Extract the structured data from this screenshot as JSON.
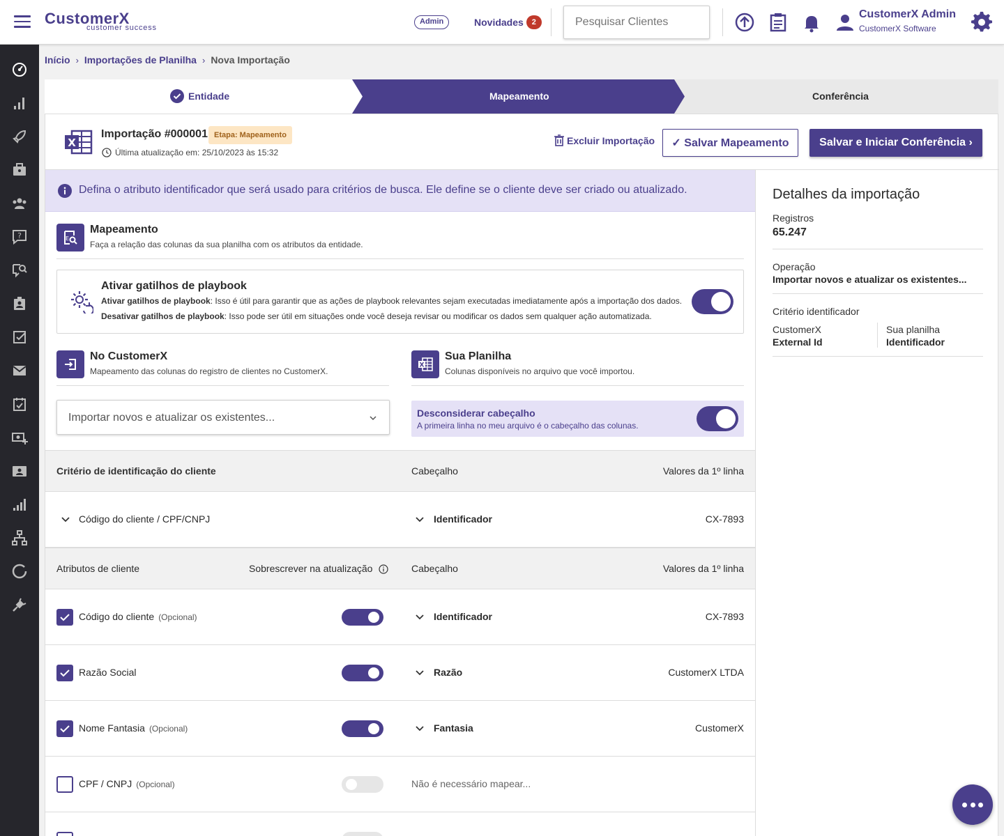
{
  "topbar": {
    "logo_text": "CustomerX",
    "logo_subtitle": "customer success",
    "admin_badge": "Admin",
    "novidades_label": "Novidades",
    "novidades_count": "2",
    "search_placeholder": "Pesquisar Clientes",
    "user_name": "CustomerX Admin",
    "user_company": "CustomerX Software",
    "icons": [
      "upload-icon",
      "clipboard-icon",
      "bell-icon",
      "user-icon",
      "gear-icon"
    ]
  },
  "sidebar": {
    "icons": [
      "dashboard-icon",
      "chart-icon",
      "rocket-icon",
      "briefcase-icon",
      "users-icon",
      "help-icon",
      "chat-search-icon",
      "contact-icon",
      "task-icon",
      "mail-icon",
      "calendar-icon",
      "money-add-icon",
      "id-card-icon",
      "analytics-icon",
      "network-icon",
      "sync-icon",
      "plug-icon"
    ]
  },
  "breadcrumb": {
    "items": [
      "Início",
      "Importações de Planilha"
    ],
    "current": "Nova Importação"
  },
  "stepper": {
    "steps": [
      "Entidade",
      "Mapeamento",
      "Conferência"
    ],
    "active": "Mapeamento"
  },
  "header": {
    "title": "Importação #000001",
    "stage_badge": "Etapa: Mapeamento",
    "last_update": "Última atualização em: 25/10/2023 às 15:32",
    "delete_label": "Excluir Importação",
    "save_label": "Salvar Mapeamento",
    "save_continue_label": "Salvar e Iniciar Conferência"
  },
  "info_banner": "Defina o atributo identificador que será usado para critérios de busca. Ele define se o cliente deve ser criado ou atualizado.",
  "mapping_section": {
    "title": "Mapeamento",
    "subtitle": "Faça a relação das colunas da sua planilha com os atributos da entidade."
  },
  "playbook": {
    "title": "Ativar gatilhos de playbook",
    "enable_label": "Ativar gatilhos de playbook",
    "enable_text": ": Isso é útil para garantir que as ações de playbook relevantes sejam executadas imediatamente após a importação dos dados.",
    "disable_label": "Desativar gatilhos de playbook",
    "disable_text": ": Isso pode ser útil em situações onde você deseja revisar ou modificar os dados sem qualquer ação automatizada.",
    "enabled": true
  },
  "customerx_section": {
    "title": "No CustomerX",
    "subtitle": "Mapeamento das colunas do registro de clientes no CustomerX.",
    "operation_value": "Importar novos e atualizar os existentes..."
  },
  "spreadsheet_section": {
    "title": "Sua Planilha",
    "subtitle": "Colunas disponíveis no arquivo que você importou.",
    "header_toggle_title": "Desconsiderar cabeçalho",
    "header_toggle_sub": "A primeira linha no meu arquivo é o cabeçalho das colunas.",
    "header_toggle_on": true
  },
  "criteria_table": {
    "headers": [
      "Critério de identificação do cliente",
      "Cabeçalho",
      "Valores da 1º linha"
    ],
    "row": {
      "attribute": "Código do cliente / CPF/CNPJ",
      "column": "Identificador",
      "value": "CX-7893"
    }
  },
  "attributes_table": {
    "headers": [
      "Atributos de cliente",
      "Sobrescrever na atualização",
      "Cabeçalho",
      "Valores da 1º linha"
    ],
    "optional_label": "(Opcional)",
    "rows": [
      {
        "attribute": "Código do cliente",
        "optional": "(Opcional)",
        "checked": true,
        "overwrite": true,
        "column": "Identificador",
        "value": "CX-7893"
      },
      {
        "attribute": "Razão Social",
        "optional": "",
        "checked": true,
        "overwrite": true,
        "column": "Razão",
        "value": "CustomerX LTDA"
      },
      {
        "attribute": "Nome Fantasia",
        "optional": "(Opcional)",
        "checked": true,
        "overwrite": true,
        "column": "Fantasia",
        "value": "CustomerX"
      },
      {
        "attribute": "CPF / CNPJ",
        "optional": "(Opcional)",
        "checked": false,
        "overwrite": false,
        "column": "Não é necessário mapear...",
        "value": ""
      }
    ]
  },
  "details": {
    "title": "Detalhes da importação",
    "records_label": "Registros",
    "records_value": "65.247",
    "operation_label": "Operação",
    "operation_value": "Importar novos e atualizar os existentes...",
    "criteria_label": "Critério identificador",
    "cx_label": "CustomerX",
    "cx_value": "External Id",
    "sheet_label": "Sua planilha",
    "sheet_value": "Identificador"
  },
  "colors": {
    "primary": "#4a3f8c",
    "sidebar": "#26262c",
    "banner": "#e5e1f6",
    "badge_bg": "#fde6c4",
    "notification": "#c0392b"
  }
}
